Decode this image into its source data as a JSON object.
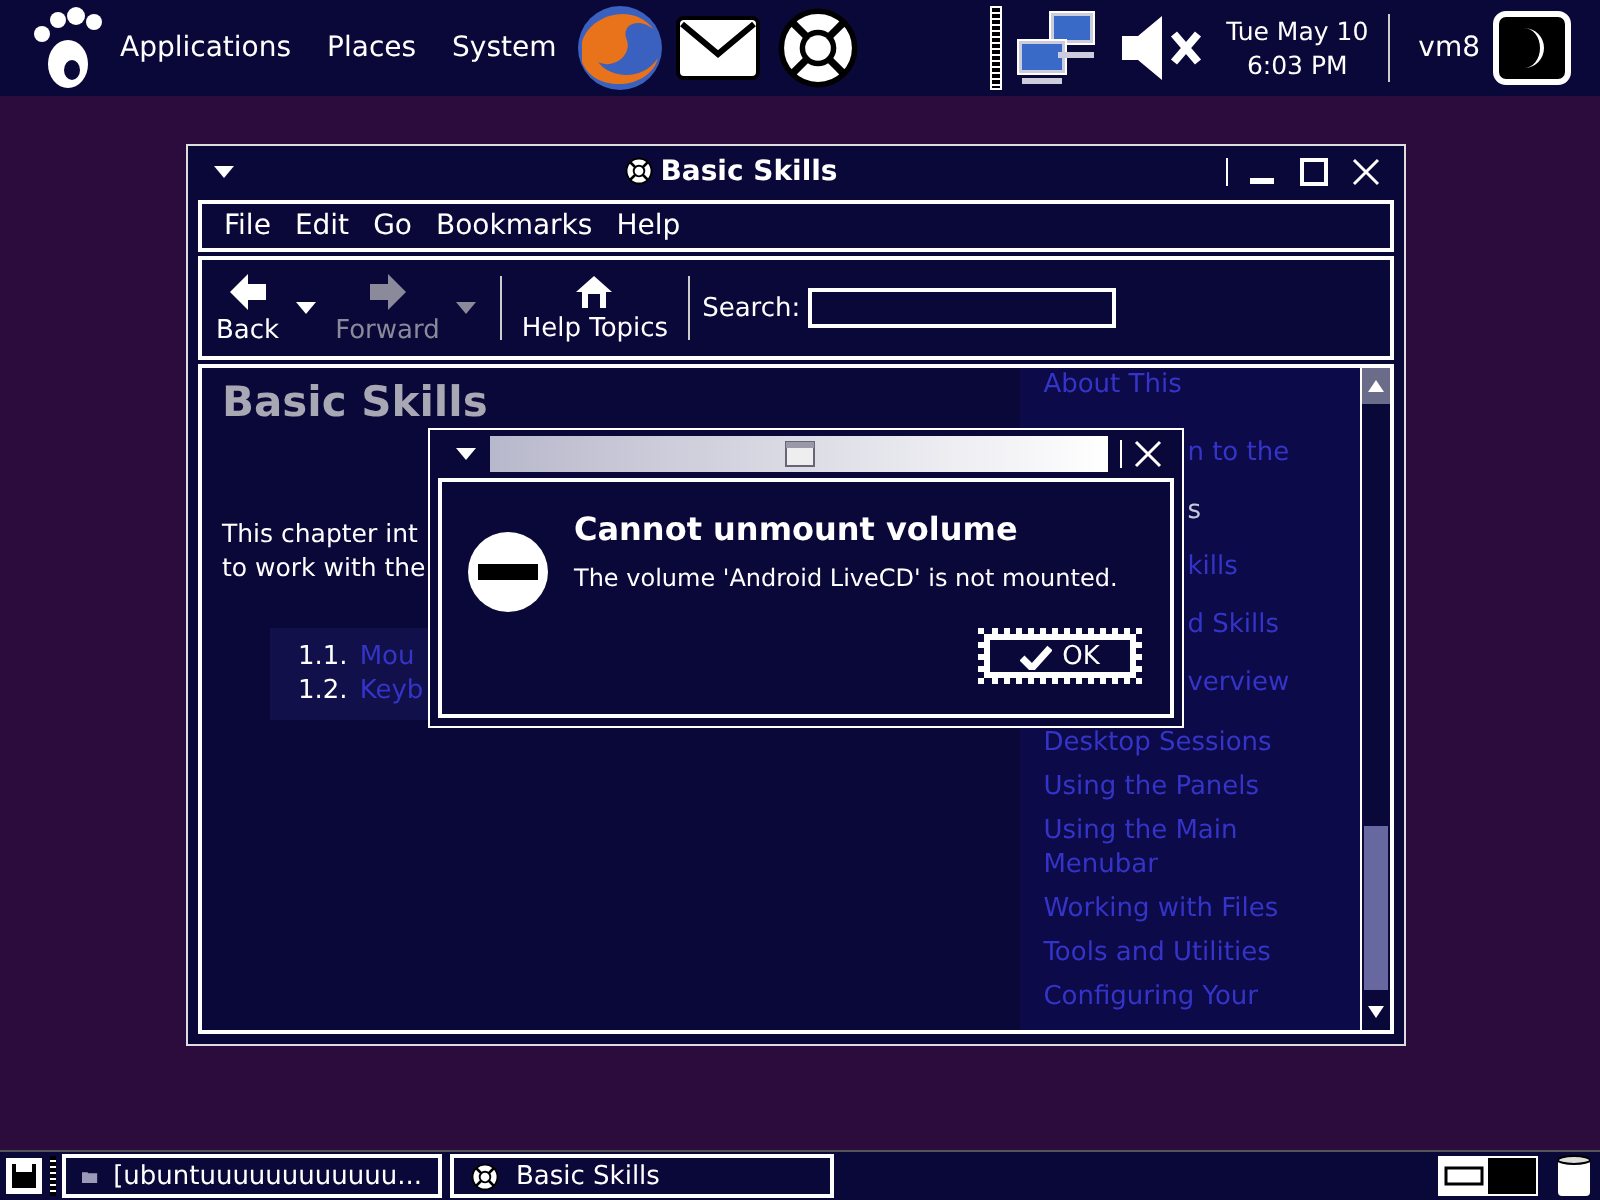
{
  "top_panel": {
    "menus": [
      "Applications",
      "Places",
      "System"
    ],
    "date": "Tue May 10",
    "time": "6:03 PM",
    "user": "vm8",
    "sound_muted": true
  },
  "window": {
    "title": "Basic Skills",
    "menu": [
      "File",
      "Edit",
      "Go",
      "Bookmarks",
      "Help"
    ],
    "toolbar": [
      {
        "label": "Back",
        "kind": "back",
        "disabled": false
      },
      {
        "label": "Forward",
        "kind": "forward",
        "disabled": true
      },
      {
        "label": "Help Topics",
        "kind": "home",
        "disabled": false
      }
    ],
    "search": {
      "label": "Search:"
    },
    "page": {
      "heading": "Basic Skills",
      "intro": [
        "This chapter int",
        "to work with the"
      ],
      "toc": [
        {
          "number": "1.1.",
          "title": "Mou"
        },
        {
          "number": "1.2.",
          "title": "Keyb"
        }
      ]
    },
    "contents": [
      {
        "text": "About This",
        "kind": "link",
        "selected": false
      },
      {
        "text": "n to the",
        "kind": "cut",
        "selected": false
      },
      {
        "text": "s",
        "kind": "cut",
        "selected": true
      },
      {
        "text": "kills",
        "kind": "cut",
        "selected": false
      },
      {
        "text": "d Skills",
        "kind": "cut",
        "selected": false
      },
      {
        "text": "verview",
        "kind": "cut",
        "selected": false
      },
      {
        "text": "Desktop Sessions",
        "kind": "link",
        "selected": false
      },
      {
        "text": "Using the Panels",
        "kind": "link",
        "selected": false
      },
      {
        "text": "Using the Main Menubar",
        "kind": "link",
        "selected": false
      },
      {
        "text": "Working with Files",
        "kind": "link",
        "selected": false
      },
      {
        "text": "Tools and Utilities",
        "kind": "link",
        "selected": false
      },
      {
        "text": "Configuring Your",
        "kind": "link",
        "selected": false
      }
    ]
  },
  "dialog": {
    "heading": "Cannot unmount volume",
    "message": "The volume 'Android LiveCD' is not mounted.",
    "button": "OK",
    "button_focused": true
  },
  "taskbar": {
    "tasks": [
      {
        "label": "[ubuntuuuuuuuuuuuu...",
        "kind": "folder"
      },
      {
        "label": "Basic Skills",
        "kind": "help"
      }
    ]
  }
}
